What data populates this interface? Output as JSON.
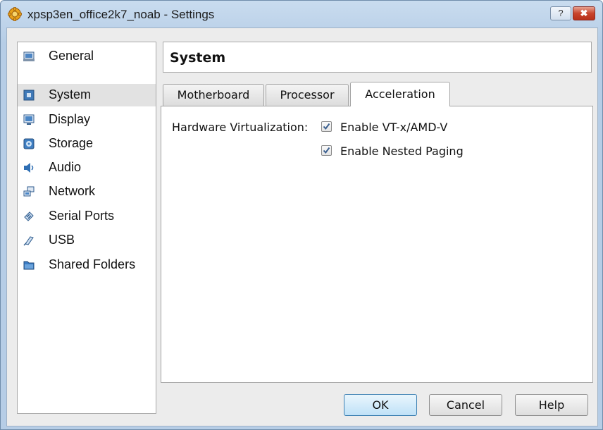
{
  "window": {
    "title": "xpsp3en_office2k7_noab - Settings",
    "help_label": "?",
    "close_label": "✖"
  },
  "sidebar": {
    "items": [
      {
        "label": "General",
        "icon": "general-icon"
      },
      {
        "label": "System",
        "icon": "system-icon",
        "selected": true
      },
      {
        "label": "Display",
        "icon": "display-icon"
      },
      {
        "label": "Storage",
        "icon": "storage-icon"
      },
      {
        "label": "Audio",
        "icon": "audio-icon"
      },
      {
        "label": "Network",
        "icon": "network-icon"
      },
      {
        "label": "Serial Ports",
        "icon": "serial-ports-icon"
      },
      {
        "label": "USB",
        "icon": "usb-icon"
      },
      {
        "label": "Shared Folders",
        "icon": "shared-folders-icon"
      }
    ]
  },
  "section": {
    "title": "System"
  },
  "tabs": [
    {
      "label": "Motherboard",
      "active": false
    },
    {
      "label": "Processor",
      "active": false
    },
    {
      "label": "Acceleration",
      "active": true
    }
  ],
  "acceleration": {
    "hardware_virtualization_label": "Hardware Virtualization:",
    "options": [
      {
        "label": "Enable VT-x/AMD-V",
        "checked": true
      },
      {
        "label": "Enable Nested Paging",
        "checked": true
      }
    ]
  },
  "buttons": {
    "ok": "OK",
    "cancel": "Cancel",
    "help": "Help"
  },
  "colors": {
    "title_bar": "#b6cde6",
    "close_button": "#c8442c",
    "default_button": "#bfe1f7",
    "selected_item": "#e2e2e2"
  }
}
